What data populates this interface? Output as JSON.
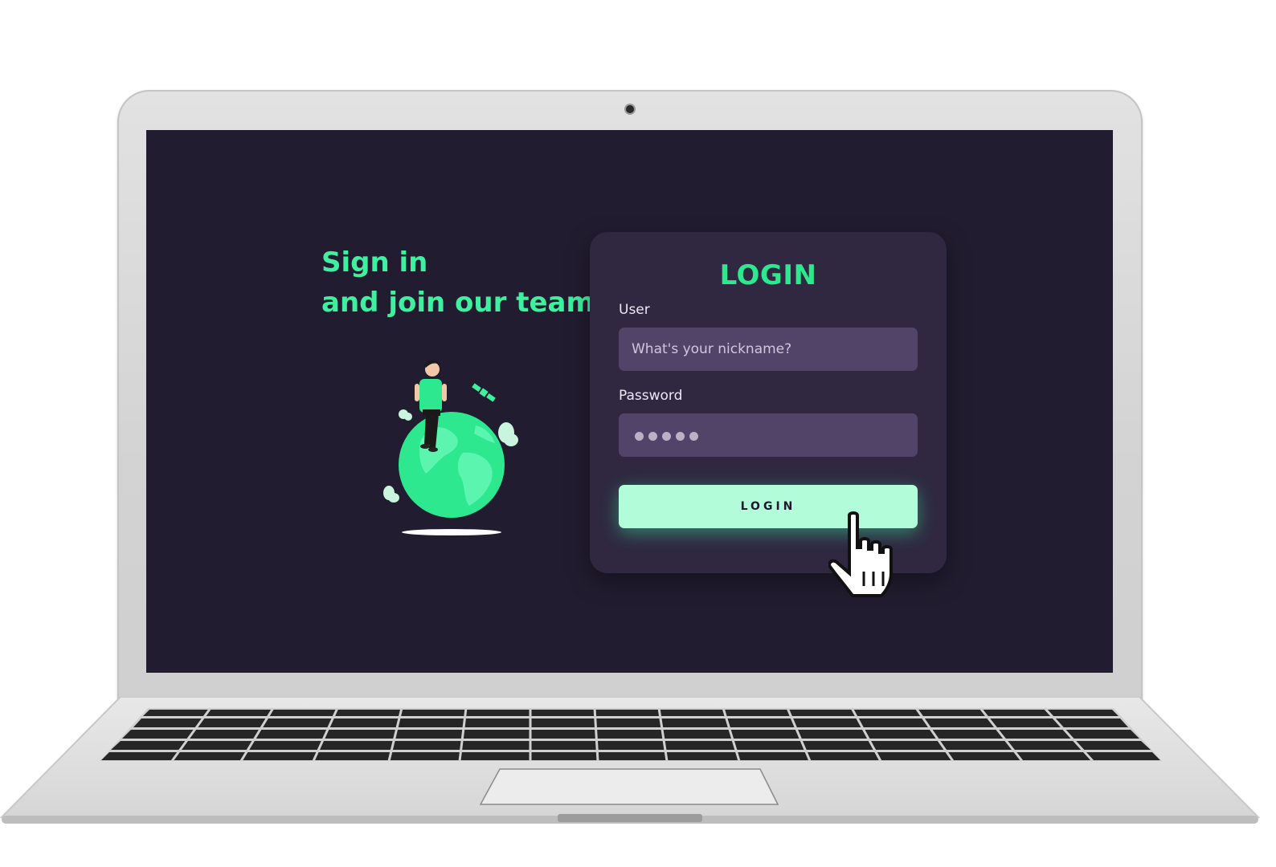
{
  "hero": {
    "line1": "Sign in",
    "line2": "and join our team"
  },
  "illustration": {
    "icon": "person-sitting-on-globe-illustration"
  },
  "login_form": {
    "title": "LOGIN",
    "user_label": "User",
    "user_placeholder": "What's your nickname?",
    "password_label": "Password",
    "password_masked_length": 5,
    "submit_label": "LOGIN"
  },
  "colors": {
    "screen_background": "#211c2f",
    "card_background": "#2f2840",
    "accent_green": "#3ef0a0",
    "input_background": "#524469",
    "button_background": "#b3fcd9"
  },
  "cursor": {
    "icon": "hand-pointer-cursor"
  }
}
